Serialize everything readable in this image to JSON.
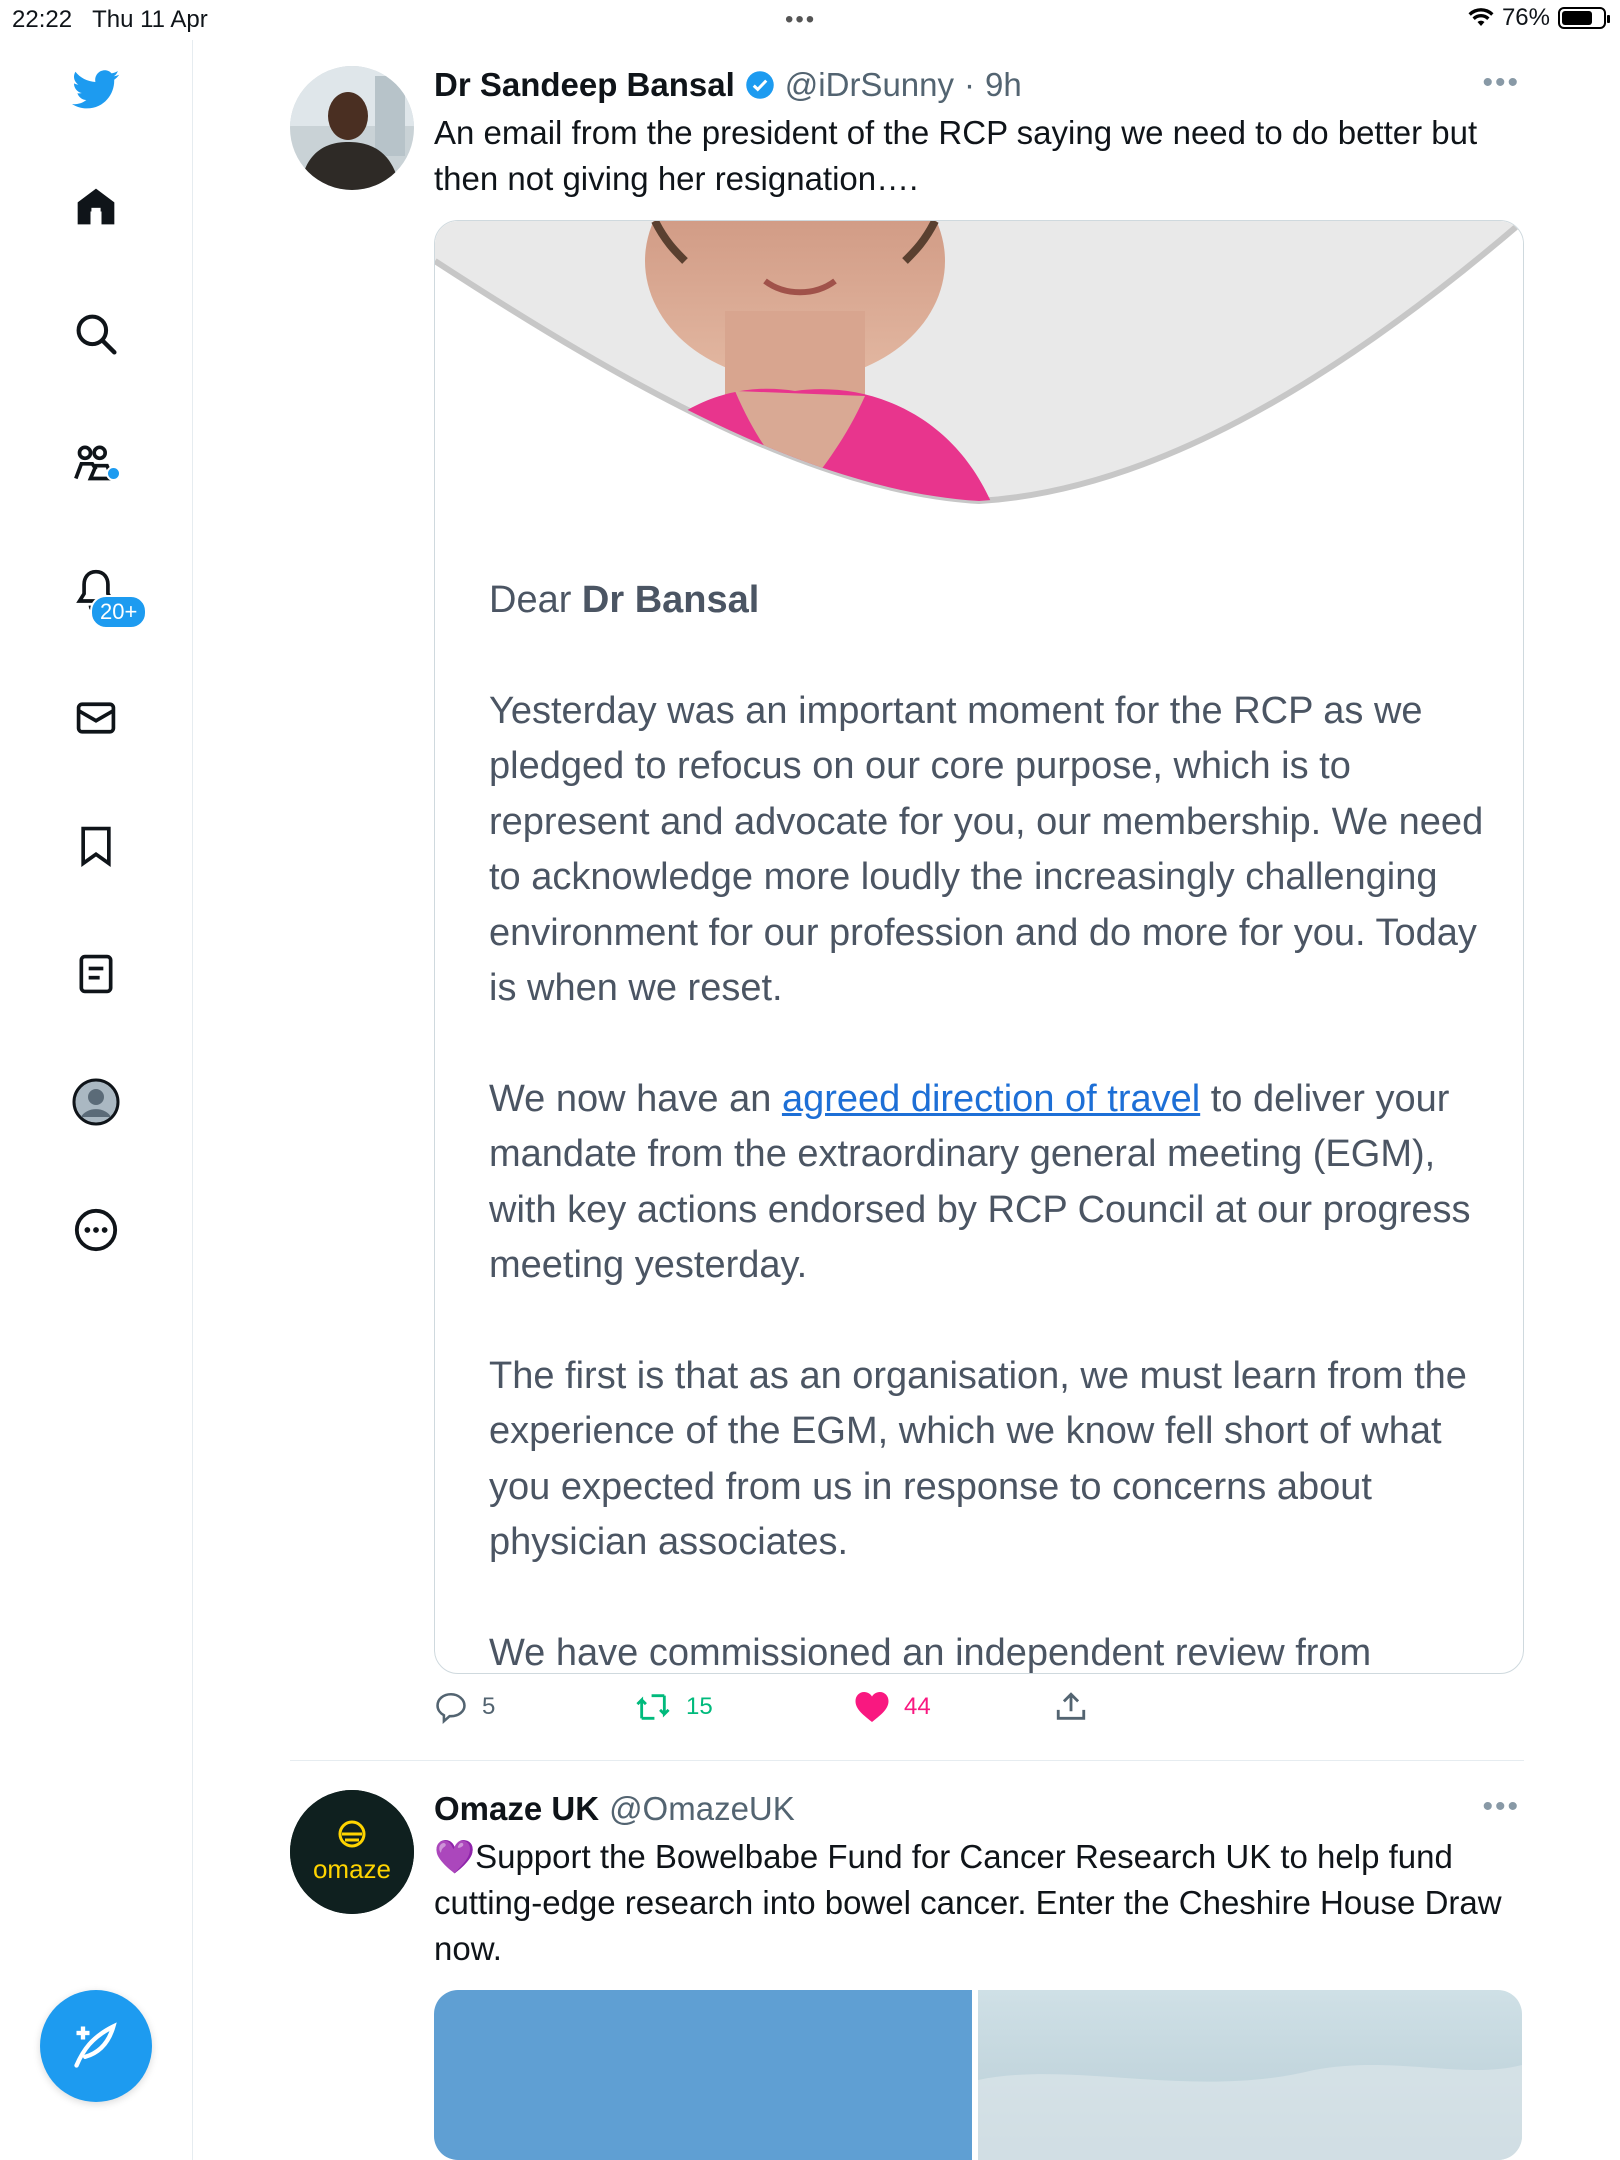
{
  "status_bar": {
    "time": "22:22",
    "date": "Thu 11 Apr",
    "battery": "76%",
    "battery_level": 0.76
  },
  "sidebar": {
    "items": [
      {
        "icon": "twitter-bird-logo-icon"
      },
      {
        "icon": "home-icon"
      },
      {
        "icon": "search-icon"
      },
      {
        "icon": "communities-icon"
      },
      {
        "icon": "notifications-bell-icon",
        "badge": "20+"
      },
      {
        "icon": "messages-envelope-icon"
      },
      {
        "icon": "bookmark-icon"
      },
      {
        "icon": "lists-icon"
      },
      {
        "icon": "profile-avatar-icon"
      },
      {
        "icon": "more-icon"
      }
    ],
    "compose_icon": "compose-tweet-icon",
    "accent": "#1d9bf0"
  },
  "tweets": [
    {
      "name": "Dr Sandeep Bansal",
      "verified": true,
      "handle": "@iDrSunny",
      "sep": "·",
      "time": "9h",
      "text": "An email from the president of the RCP saying we need to do better but then not giving her resignation….",
      "email": {
        "greeting_prefix": "Dear ",
        "greeting_name": "Dr Bansal",
        "p1": "Yesterday was an important moment for the RCP as we pledged to refocus on our core purpose, which is to represent and advocate for you, our membership. We need to acknowledge more loudly the increasingly challenging environment for our profession and do more for you. Today is when we reset.",
        "p2_before": "We now have an ",
        "p2_link": "agreed direction of travel",
        "p2_after": " to deliver your mandate from the extraordinary general meeting (EGM), with key actions endorsed by RCP Council at our progress meeting yesterday.",
        "p3": "The first is that as an organisation, we must learn from the experience of the EGM, which we know fell short of what you expected from us in response to concerns about physician associates.",
        "p4": "We have commissioned an independent review from"
      },
      "actions": {
        "replies": "5",
        "retweets": "15",
        "likes": "44"
      }
    },
    {
      "name": "Omaze UK",
      "handle": "@OmazeUK",
      "avatar_text": "omaze",
      "emoji": "💜",
      "text": "Support the Bowelbabe Fund for Cancer Research UK to help fund cutting-edge research into bowel cancer. Enter the Cheshire House Draw now."
    }
  ],
  "colors": {
    "like": "#f91880",
    "retweet": "#00ba7c",
    "link": "#1d6fd6"
  }
}
